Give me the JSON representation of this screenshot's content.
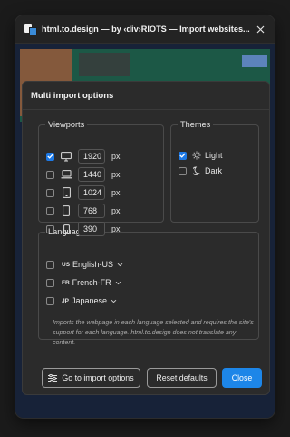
{
  "window": {
    "title": "html.to.design — by ‹div›RIOTS — Import websites..."
  },
  "modal": {
    "title": "Multi import options",
    "viewports": {
      "legend": "Viewports",
      "unit": "px",
      "items": [
        {
          "device": "desktop-icon",
          "width": "1920",
          "checked": true
        },
        {
          "device": "laptop-icon",
          "width": "1440",
          "checked": false
        },
        {
          "device": "tablet-icon",
          "width": "1024",
          "checked": false
        },
        {
          "device": "tablet-small-icon",
          "width": "768",
          "checked": false
        },
        {
          "device": "phone-icon",
          "width": "390",
          "checked": false
        }
      ]
    },
    "themes": {
      "legend": "Themes",
      "items": [
        {
          "icon": "sun-icon",
          "label": "Light",
          "checked": true
        },
        {
          "icon": "moon-icon",
          "label": "Dark",
          "checked": false
        }
      ]
    },
    "languages": {
      "legend": "Languages",
      "items": [
        {
          "code": "US",
          "label": "English-US",
          "checked": false
        },
        {
          "code": "FR",
          "label": "French-FR",
          "checked": false
        },
        {
          "code": "JP",
          "label": "Japanese",
          "checked": false
        }
      ],
      "note": "Imports the webpage in each language selected and requires the site's support for each language. html.to.design does not translate any content."
    },
    "buttons": {
      "import_options": "Go to import options",
      "reset": "Reset defaults",
      "close": "Close"
    }
  },
  "colors": {
    "accent": "#1d86e8",
    "checkbox_on": "#1d79e6"
  }
}
